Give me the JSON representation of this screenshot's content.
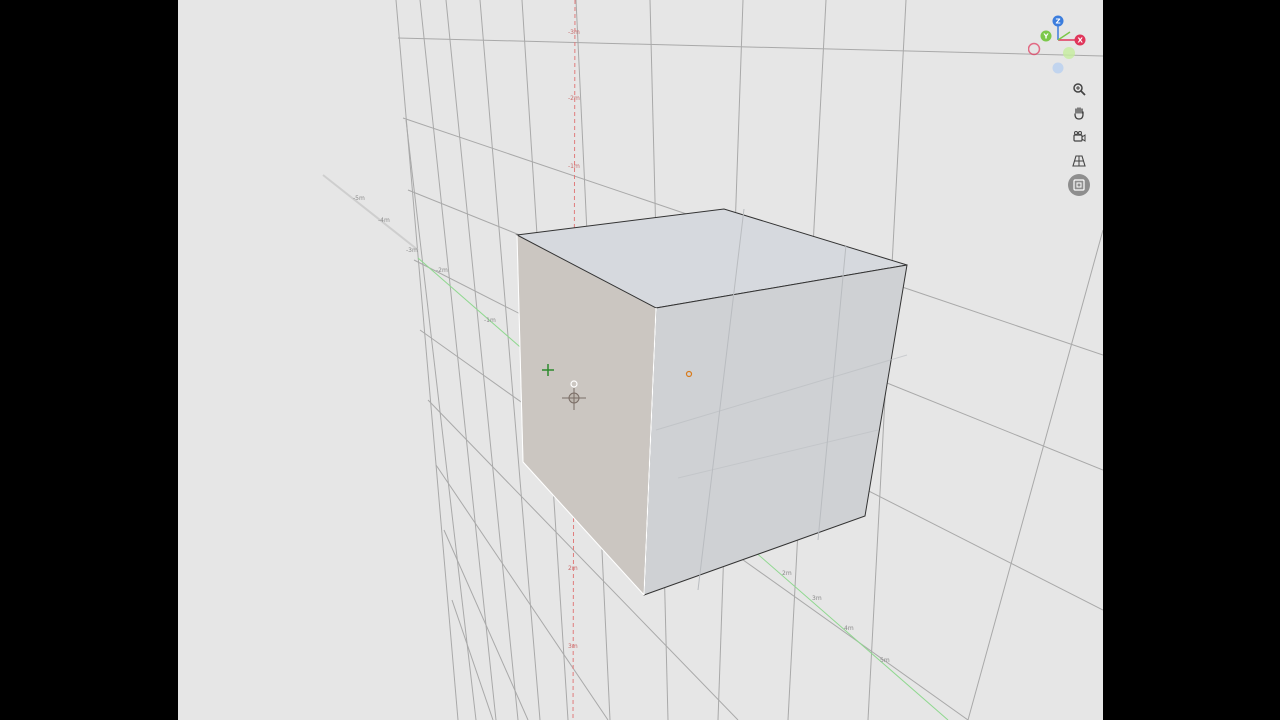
{
  "viewport": {
    "background": "#e6e6e6",
    "grid_color": "#a8a8a8",
    "x_axis_color": "#8fd88f",
    "z_axis_color": "#e07c7c"
  },
  "gizmo": {
    "z_label": "Z",
    "y_label": "Y",
    "x_label": "X",
    "z_color": "#3b7ddd",
    "y_color": "#7cc84a",
    "x_color": "#e0355a"
  },
  "toolbar": {
    "zoom": "zoom-icon",
    "pan": "hand-icon",
    "orbit": "camera-icon",
    "grid": "grid-icon",
    "frame": "frame-icon"
  },
  "object": {
    "name": "cube",
    "face_top": "#d6d9de",
    "face_front": "#cfd1d4",
    "face_left": "#cbc6c1"
  },
  "axis_ticks": {
    "vertical": [
      "-3m",
      "-2m",
      "-1m",
      "1m",
      "2m",
      "3m"
    ],
    "depth": [
      "-5m",
      "-4m",
      "-3m",
      "-2m",
      "-1m",
      "1m",
      "2m",
      "3m",
      "4m",
      "5m"
    ]
  }
}
